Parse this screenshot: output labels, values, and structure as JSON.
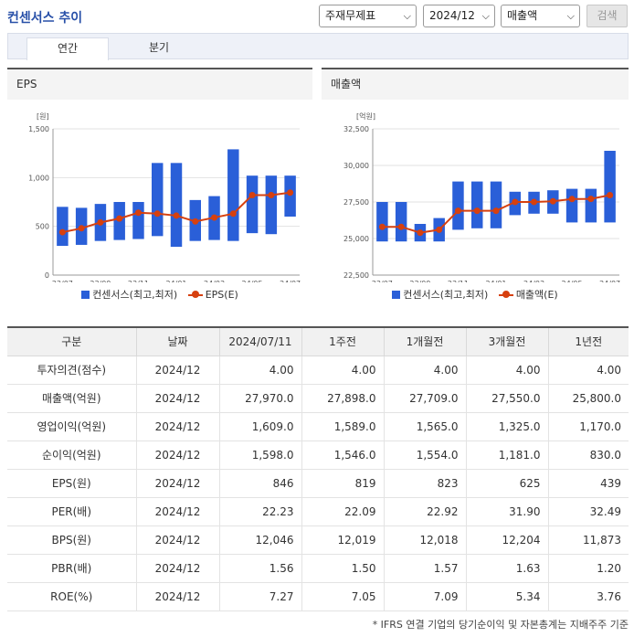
{
  "header": {
    "title": "컨센서스 추이",
    "search_label": "검색"
  },
  "filters": [
    {
      "name": "report-type-select",
      "value": "주재무제표"
    },
    {
      "name": "period-select",
      "value": "2024/12"
    },
    {
      "name": "metric-select",
      "value": "매출액"
    }
  ],
  "tabs": [
    {
      "label": "연간"
    },
    {
      "label": "분기"
    }
  ],
  "chart_data": [
    {
      "type": "bar",
      "panel_title": "EPS",
      "unit_label": "[원]",
      "categories": [
        "23/07",
        "23/08",
        "23/09",
        "23/10",
        "23/11",
        "23/12",
        "24/01",
        "24/02",
        "24/03",
        "24/04",
        "24/05",
        "24/06",
        "24/07"
      ],
      "x_tick_labels": [
        "23/07",
        "23/09",
        "23/11",
        "24/01",
        "24/03",
        "24/05",
        "24/07"
      ],
      "ylim": [
        0,
        1500
      ],
      "yticks": [
        0,
        500,
        1000,
        1500
      ],
      "ytick_labels": [
        "0",
        "500",
        "1,000",
        "1,500"
      ],
      "series": [
        {
          "name": "컨센서스(최고,최저)",
          "type": "range",
          "low": [
            300,
            310,
            350,
            360,
            370,
            400,
            290,
            350,
            360,
            350,
            430,
            420,
            600
          ],
          "high": [
            700,
            690,
            730,
            750,
            750,
            1150,
            1150,
            770,
            810,
            1290,
            1020,
            1020,
            1020
          ]
        },
        {
          "name": "EPS(E)",
          "type": "line",
          "values": [
            440,
            480,
            540,
            580,
            640,
            630,
            610,
            550,
            590,
            630,
            820,
            820,
            846
          ]
        }
      ],
      "colors": {
        "bar": "#2a5fd8",
        "line": "#d6400f"
      }
    },
    {
      "type": "bar",
      "panel_title": "매출액",
      "unit_label": "[억원]",
      "categories": [
        "23/07",
        "23/08",
        "23/09",
        "23/10",
        "23/11",
        "23/12",
        "24/01",
        "24/02",
        "24/03",
        "24/04",
        "24/05",
        "24/06",
        "24/07"
      ],
      "x_tick_labels": [
        "23/07",
        "23/09",
        "23/11",
        "24/01",
        "24/03",
        "24/05",
        "24/07"
      ],
      "ylim": [
        22500,
        32500
      ],
      "yticks": [
        22500,
        25000,
        27500,
        30000,
        32500
      ],
      "ytick_labels": [
        "22,500",
        "25,000",
        "27,500",
        "30,000",
        "32,500"
      ],
      "series": [
        {
          "name": "컨센서스(최고,최저)",
          "type": "range",
          "low": [
            24800,
            24800,
            24800,
            24800,
            25600,
            25700,
            25700,
            26600,
            26700,
            26700,
            26100,
            26100,
            26100
          ],
          "high": [
            27500,
            27500,
            26000,
            26400,
            28900,
            28900,
            28900,
            28200,
            28200,
            28300,
            28400,
            28400,
            31000
          ]
        },
        {
          "name": "매출액(E)",
          "type": "line",
          "values": [
            25800,
            25800,
            25400,
            25600,
            26900,
            26900,
            26900,
            27500,
            27500,
            27550,
            27700,
            27709,
            27970
          ]
        }
      ],
      "colors": {
        "bar": "#2a5fd8",
        "line": "#d6400f"
      }
    }
  ],
  "table": {
    "headers": [
      "구분",
      "날짜",
      "2024/07/11",
      "1주전",
      "1개월전",
      "3개월전",
      "1년전"
    ],
    "rows": [
      {
        "label": "투자의견(점수)",
        "date": "2024/12",
        "values": [
          "4.00",
          "4.00",
          "4.00",
          "4.00",
          "4.00"
        ]
      },
      {
        "label": "매출액(억원)",
        "date": "2024/12",
        "values": [
          "27,970.0",
          "27,898.0",
          "27,709.0",
          "27,550.0",
          "25,800.0"
        ]
      },
      {
        "label": "영업이익(억원)",
        "date": "2024/12",
        "values": [
          "1,609.0",
          "1,589.0",
          "1,565.0",
          "1,325.0",
          "1,170.0"
        ]
      },
      {
        "label": "순이익(억원)",
        "date": "2024/12",
        "values": [
          "1,598.0",
          "1,546.0",
          "1,554.0",
          "1,181.0",
          "830.0"
        ]
      },
      {
        "label": "EPS(원)",
        "date": "2024/12",
        "values": [
          "846",
          "819",
          "823",
          "625",
          "439"
        ]
      },
      {
        "label": "PER(배)",
        "date": "2024/12",
        "values": [
          "22.23",
          "22.09",
          "22.92",
          "31.90",
          "32.49"
        ]
      },
      {
        "label": "BPS(원)",
        "date": "2024/12",
        "values": [
          "12,046",
          "12,019",
          "12,018",
          "12,204",
          "11,873"
        ]
      },
      {
        "label": "PBR(배)",
        "date": "2024/12",
        "values": [
          "1.56",
          "1.50",
          "1.57",
          "1.63",
          "1.20"
        ]
      },
      {
        "label": "ROE(%)",
        "date": "2024/12",
        "values": [
          "7.27",
          "7.05",
          "7.09",
          "5.34",
          "3.76"
        ]
      }
    ]
  },
  "footnote": "* IFRS 연결 기업의 당기순이익 및 자본총계는 지배주주 기준"
}
